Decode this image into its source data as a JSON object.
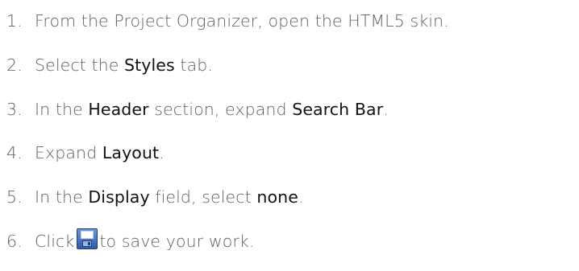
{
  "steps": [
    {
      "number": "1.",
      "parts": [
        "From the Project Organizer, open the HTML5 skin."
      ]
    },
    {
      "number": "2.",
      "parts": [
        "Select the ",
        "Styles",
        " tab."
      ]
    },
    {
      "number": "3.",
      "parts": [
        "In the ",
        "Header",
        " section, expand ",
        "Search Bar",
        "."
      ]
    },
    {
      "number": "4.",
      "parts": [
        "Expand ",
        "Layout",
        "."
      ]
    },
    {
      "number": "5.",
      "parts": [
        "In the ",
        "Display",
        " field, select ",
        "none",
        "."
      ]
    },
    {
      "number": "6.",
      "parts": [
        "Click",
        "to save your work."
      ],
      "icon": "save-icon"
    }
  ]
}
